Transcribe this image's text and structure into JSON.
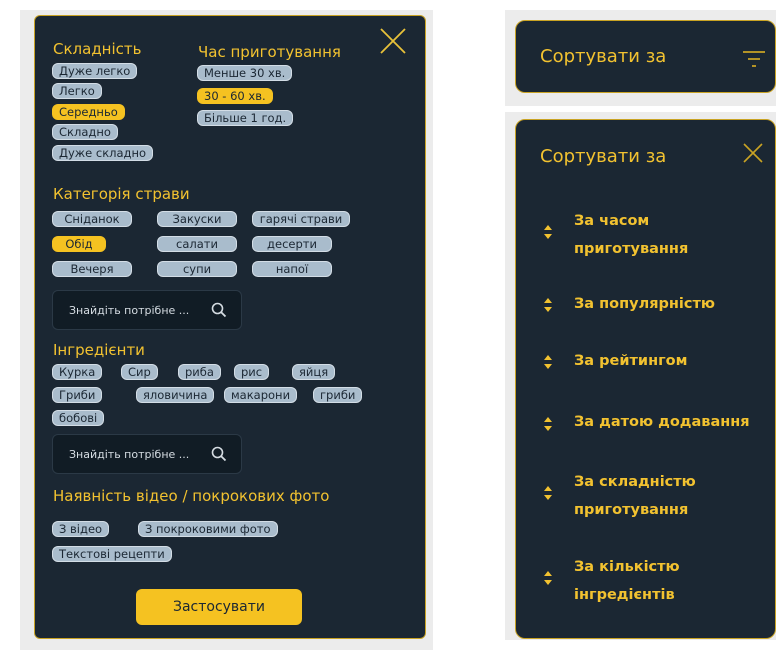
{
  "filter": {
    "difficulty": {
      "title": "Складність",
      "options": [
        "Дуже легко",
        "Легко",
        "Середньо",
        "Складно",
        "Дуже складно"
      ]
    },
    "time": {
      "title": "Час приготування",
      "options": [
        "Менше 30 хв.",
        "30 - 60 хв.",
        "Більше 1 год."
      ]
    },
    "category": {
      "title": "Категорія страви",
      "options": [
        "Сніданок",
        "Закуски",
        "гарячі страви",
        "Обід",
        "салати",
        "десерти",
        "Вечеря",
        "супи",
        "напої"
      ]
    },
    "search1_placeholder": "Знайдіть потрібне ...",
    "ingredients": {
      "title": "Інгредієнти",
      "options": [
        "Курка",
        "Сир",
        "риба",
        "рис",
        "яйця",
        "Гриби",
        "яловичина",
        "макарони",
        "гриби",
        "бобові"
      ]
    },
    "search2_placeholder": "Знайдіть потрібне ...",
    "media": {
      "title": "Наявність відео / покрокових фото",
      "options": [
        "З відео",
        "З покроковими фото",
        "Текстові рецепти"
      ]
    },
    "apply_label": "Застосувати",
    "selected": [
      "Середньо",
      "30 - 60 хв.",
      "Обід"
    ]
  },
  "sort_collapsed": {
    "title": "Сортувати за"
  },
  "sort_expanded": {
    "title": "Сортувати за",
    "items": [
      {
        "line1": "За часом",
        "line2": "приготування"
      },
      {
        "line1": "За популярністю"
      },
      {
        "line1": "За рейтингом"
      },
      {
        "line1": "За датою додавання"
      },
      {
        "line1": "За складністю",
        "line2": "приготування"
      },
      {
        "line1": "За кількістю",
        "line2": "інгредієнтів"
      }
    ]
  },
  "colors": {
    "panel": "#1b2733",
    "accent": "#f5c221",
    "chip": "#a9bccc"
  }
}
